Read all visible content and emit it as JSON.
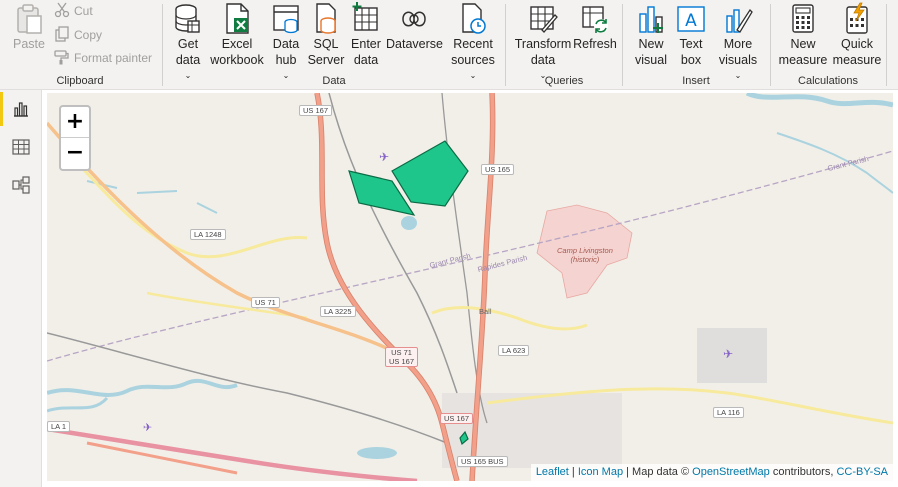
{
  "ribbon": {
    "clipboard": {
      "label": "Clipboard",
      "paste": "Paste",
      "cut": "Cut",
      "copy": "Copy",
      "format_painter": "Format painter"
    },
    "data": {
      "label": "Data",
      "get_data": [
        "Get",
        "data"
      ],
      "excel": [
        "Excel",
        "workbook"
      ],
      "data_hub": [
        "Data",
        "hub"
      ],
      "sql": [
        "SQL",
        "Server"
      ],
      "enter": [
        "Enter",
        "data"
      ],
      "dataverse": "Dataverse",
      "recent": [
        "Recent",
        "sources"
      ]
    },
    "queries": {
      "label": "Queries",
      "transform": [
        "Transform",
        "data"
      ],
      "refresh": "Refresh"
    },
    "insert": {
      "label": "Insert",
      "new_visual": [
        "New",
        "visual"
      ],
      "text_box": [
        "Text",
        "box"
      ],
      "more_visuals": [
        "More",
        "visuals"
      ]
    },
    "calculations": {
      "label": "Calculations",
      "new_measure": [
        "New",
        "measure"
      ],
      "quick_measure": [
        "Quick",
        "measure"
      ]
    }
  },
  "rail": {
    "items": [
      "report-view",
      "table-view",
      "model-view"
    ]
  },
  "map": {
    "zoom_in": "+",
    "zoom_out": "−",
    "attribution": {
      "leaflet": "Leaflet",
      "sep1": " | ",
      "icon_map": "Icon Map",
      "sep2": " | Map data © ",
      "osm": "OpenStreetMap",
      "contrib": " contributors, ",
      "license": "CC-BY-SA"
    },
    "labels": {
      "us167_top": "US 167",
      "us165": "US 165",
      "la1248": "LA 1248",
      "us71": "US 71",
      "la3225": "LA 3225",
      "ball": "Ball",
      "la623": "LA 623",
      "us71_us167": [
        "US 71",
        "US 167"
      ],
      "us167_bottom": "US 167",
      "us165_bus": "US 165 BUS",
      "la116": "LA 116",
      "la1": "LA 1",
      "camp_livingston": [
        "Camp Livingston",
        "(historic)"
      ],
      "grant_parish": "Grant Parish",
      "rapides_parish": "Rapides Parish",
      "grant_parish_east": "Grant Parish"
    },
    "colors": {
      "polygon_fill": "#1fc68c",
      "polygon_stroke": "#0b6b45",
      "land": "#f2efe9",
      "water": "#aad3df",
      "highway": "#f3a08a",
      "highway_casing": "#d9836c"
    }
  }
}
